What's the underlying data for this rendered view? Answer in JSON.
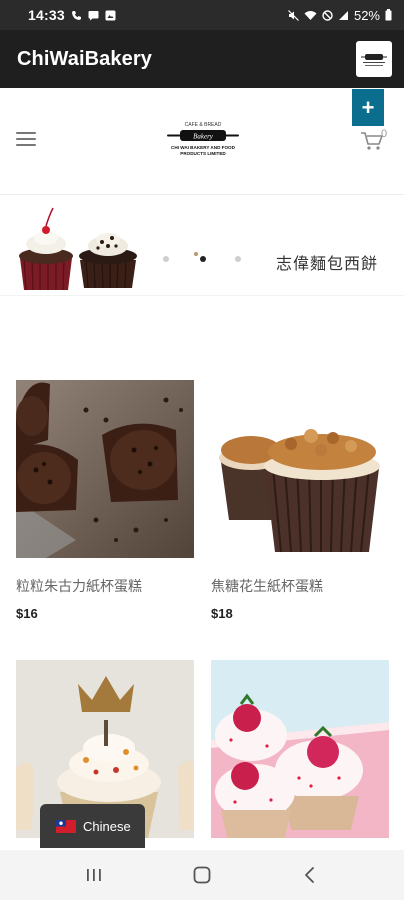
{
  "status_bar": {
    "time": "14:33",
    "battery": "52%"
  },
  "app_bar": {
    "title": "ChiWaiBakery"
  },
  "header": {
    "cart_count": "0",
    "plus_label": "+",
    "logo_text": "Bakery",
    "logo_top": "CAFE & BREAD",
    "logo_line1": "CHI WAI BAKERY AND FOOD",
    "logo_line2": "PRODUCTS LIMITED"
  },
  "banner": {
    "title": "志偉麵包西餅",
    "slide_count": 3,
    "active_slide": 2
  },
  "products": [
    {
      "name": "粒粒朱古力紙杯蛋糕",
      "price": "$16"
    },
    {
      "name": "焦糖花生紙杯蛋糕",
      "price": "$18"
    },
    {
      "name": "",
      "price": ""
    },
    {
      "name": "",
      "price": ""
    }
  ],
  "language": {
    "label": "Chinese"
  },
  "colors": {
    "accent": "#0b6e8e",
    "app_bar": "#1f1f1f",
    "status_bar": "#2b2b2b"
  },
  "icons": [
    "hamburger-menu-icon",
    "cart-icon",
    "plus-icon",
    "taiwan-flag-icon",
    "recents-icon",
    "home-icon",
    "back-icon"
  ]
}
